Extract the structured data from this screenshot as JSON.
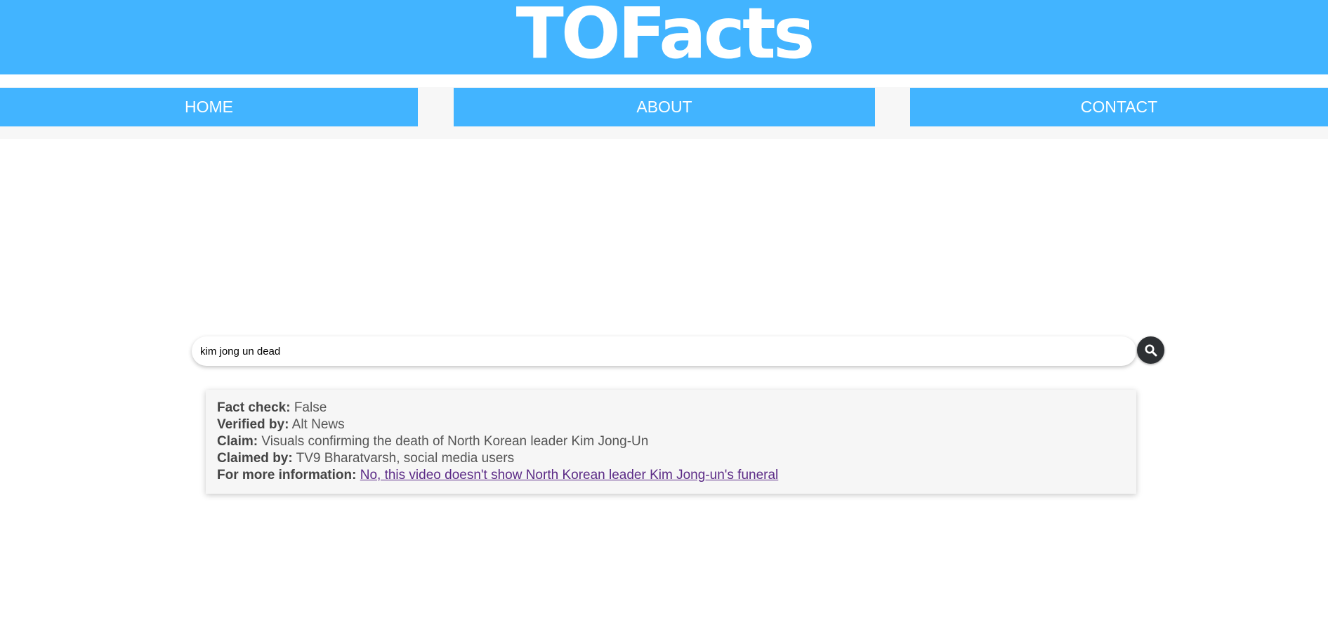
{
  "header": {
    "title": "TOFacts",
    "background_color": "#42b4ff"
  },
  "nav": {
    "items": [
      {
        "label": "HOME"
      },
      {
        "label": "ABOUT"
      },
      {
        "label": "CONTACT"
      }
    ]
  },
  "search": {
    "value": "kim jong un dead",
    "button_icon": "search-icon"
  },
  "result": {
    "fact_check_label": "Fact check:",
    "fact_check_value": "False",
    "verified_by_label": "Verified by:",
    "verified_by_value": "Alt News",
    "claim_label": "Claim:",
    "claim_value": "Visuals confirming the death of North Korean leader Kim Jong-Un",
    "claimed_by_label": "Claimed by:",
    "claimed_by_value": "TV9 Bharatvarsh, social media users",
    "more_info_label": "For more information:",
    "more_info_link": "No, this video doesn't show North Korean leader Kim Jong-un's funeral"
  },
  "colors": {
    "accent": "#42b4ff",
    "link_visited": "#5b2a86",
    "search_button": "#2d3033"
  }
}
